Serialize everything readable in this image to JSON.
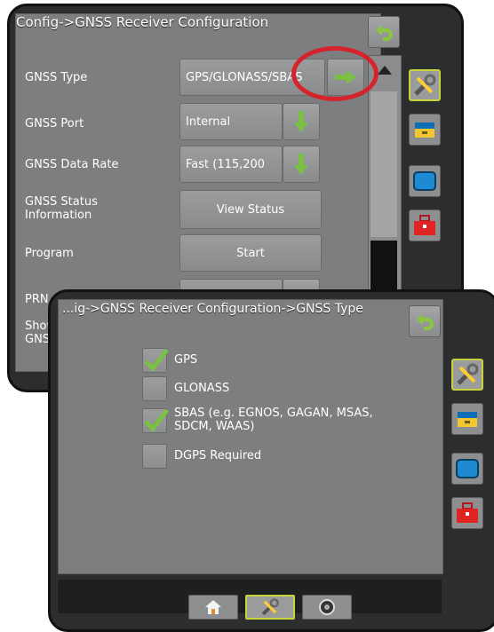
{
  "back_panel": {
    "title": "Config->GNSS Receiver Configuration",
    "rows": [
      {
        "label": "GNSS Type",
        "value": "GPS/GLONASS/SBAS"
      },
      {
        "label": "GNSS Port",
        "value": "Internal"
      },
      {
        "label": "GNSS Data Rate",
        "value": "Fast (115,200"
      },
      {
        "label": "GNSS Status Information",
        "button": "View Status"
      },
      {
        "label": "Program",
        "button": "Start"
      },
      {
        "label": "PRN"
      },
      {
        "label": "Show GNSS"
      }
    ]
  },
  "front_panel": {
    "title": "...ig->GNSS Receiver Configuration->GNSS Type",
    "options": [
      {
        "label": "GPS",
        "checked": true
      },
      {
        "label": "GLONASS",
        "checked": false
      },
      {
        "label": "SBAS (e.g. EGNOS, GAGAN, MSAS, SDCM, WAAS)",
        "checked": true
      },
      {
        "label": "DGPS Required",
        "checked": false
      }
    ]
  },
  "side_nav": [
    "tools-icon",
    "console-icon",
    "display-icon",
    "toolbox-icon"
  ],
  "bottom_tabs": [
    "home-icon",
    "tools-icon",
    "camera-icon"
  ],
  "colors": {
    "panel_bg": "#2c2d2e",
    "content_bg": "#7d7e80",
    "active_border": "#c8d23a",
    "highlight": "#d6222a",
    "green": "#7ac143"
  }
}
